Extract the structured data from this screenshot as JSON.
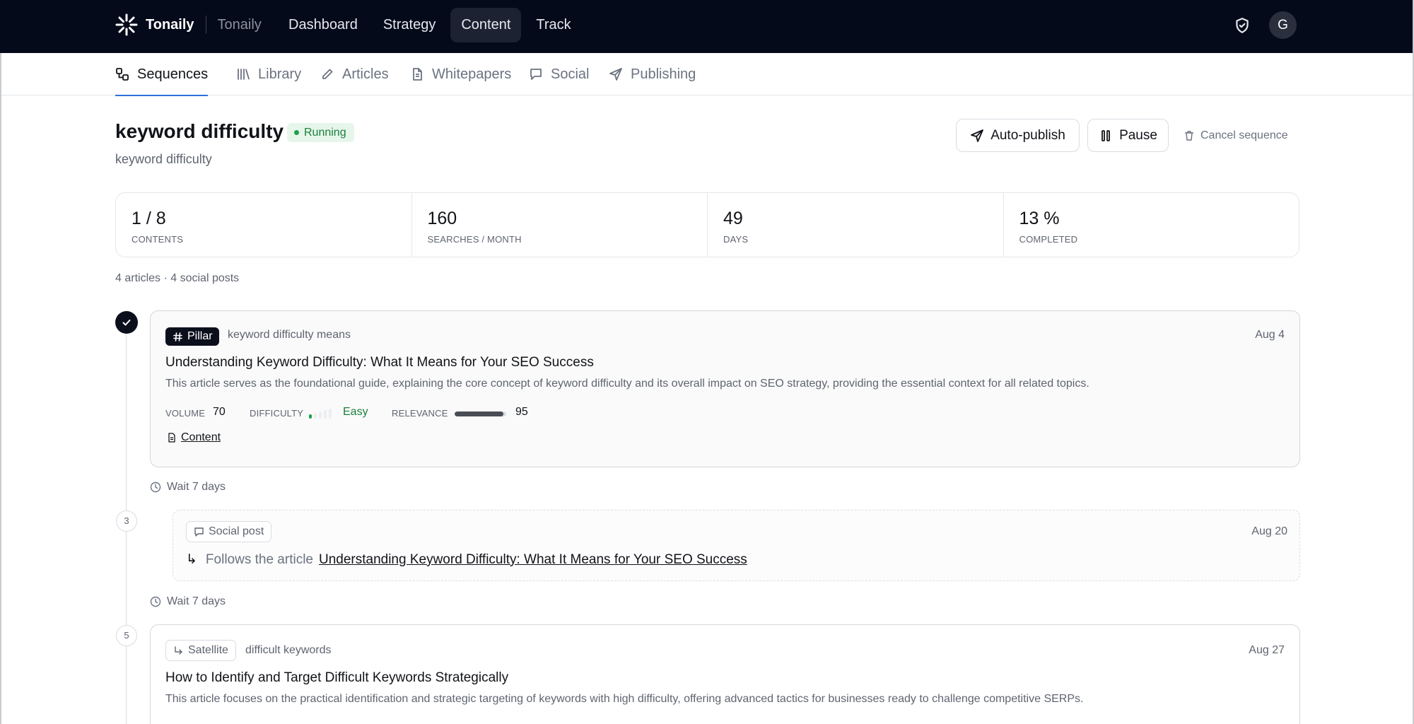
{
  "app": {
    "brand": "Tonaily",
    "workspace": "Tonaily",
    "avatar_initial": "G"
  },
  "nav": [
    {
      "label": "Dashboard"
    },
    {
      "label": "Strategy"
    },
    {
      "label": "Content",
      "active": true
    },
    {
      "label": "Track"
    }
  ],
  "tabs": [
    {
      "label": "Sequences",
      "icon": "sequences-icon",
      "active": true
    },
    {
      "label": "Library",
      "icon": "library-icon"
    },
    {
      "label": "Articles",
      "icon": "pencil-icon"
    },
    {
      "label": "Whitepapers",
      "icon": "document-icon"
    },
    {
      "label": "Social",
      "icon": "chat-icon"
    },
    {
      "label": "Publishing",
      "icon": "send-icon"
    }
  ],
  "header": {
    "title": "keyword difficulty",
    "status": "Running",
    "subtitle": "keyword difficulty",
    "auto_publish": "Auto-publish",
    "pause": "Pause",
    "cancel": "Cancel sequence"
  },
  "stats": [
    {
      "value": "1 / 8",
      "label": "CONTENTS"
    },
    {
      "value": "160",
      "label": "SEARCHES / MONTH"
    },
    {
      "value": "49",
      "label": "DAYS"
    },
    {
      "value": "13 %",
      "label": "COMPLETED"
    }
  ],
  "summary": "4 articles · 4 social posts",
  "labels": {
    "volume": "VOLUME",
    "difficulty": "DIFFICULTY",
    "relevance": "RELEVANCE",
    "content_link": "Content",
    "follows": "Follows the article",
    "follows_arrow": "↳"
  },
  "items": [
    {
      "type": "Pillar",
      "keyword": "keyword difficulty means",
      "date": "Aug 4",
      "title": "Understanding Keyword Difficulty: What It Means for Your SEO Success",
      "description": "This article serves as the foundational guide, explaining the core concept of keyword difficulty and its overall impact on SEO strategy, providing the essential context for all related topics.",
      "volume": "70",
      "difficulty": "Easy",
      "difficulty_level": 1,
      "relevance": "95",
      "relevance_fraction": 0.95,
      "status": "done"
    },
    {
      "wait": "Wait 7 days"
    },
    {
      "step": "3",
      "type": "Social post",
      "date": "Aug 20",
      "follows_title": "Understanding Keyword Difficulty: What It Means for Your SEO Success"
    },
    {
      "wait": "Wait 7 days"
    },
    {
      "step": "5",
      "type": "Satellite",
      "keyword": "difficult keywords",
      "date": "Aug 27",
      "title": "How to Identify and Target Difficult Keywords Strategically",
      "description": "This article focuses on the practical identification and strategic targeting of keywords with high difficulty, offering advanced tactics for businesses ready to challenge competitive SERPs."
    }
  ],
  "colors": {
    "topbar": "#050a1a",
    "accent_tab": "#2f6fdb",
    "running_bg": "#e6f6ea",
    "running_text": "#1a7f3c"
  }
}
